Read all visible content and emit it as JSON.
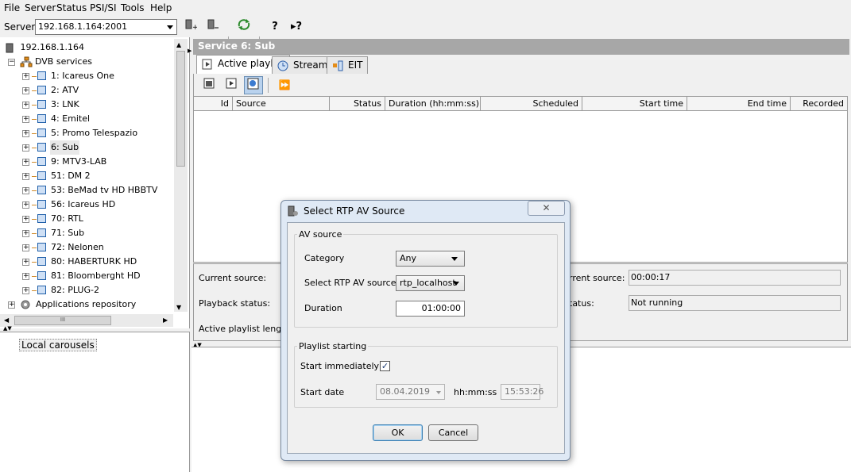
{
  "menu": [
    "File",
    "Server",
    "Status",
    "PSI/SI",
    "Tools",
    "Help"
  ],
  "toolbar": {
    "server_label": "Server",
    "server_value": "192.168.1.164:2001"
  },
  "tree": {
    "root": "192.168.1.164",
    "dvb": "DVB services",
    "services": [
      "1: Icareus One",
      "2: ATV",
      "3: LNK",
      "4: Emitel",
      "5: Promo Telespazio",
      "6: Sub",
      "9: MTV3-LAB",
      "51: DM 2",
      "53: BeMad tv HD HBBTV",
      "56: Icareus HD",
      "70: RTL",
      "71: Sub",
      "72: Nelonen",
      "80: HABERTURK HD",
      "81: Bloomberght HD",
      "82: PLUG-2"
    ],
    "apps": "Applications repository",
    "selected_index": 5
  },
  "lower_left": {
    "item": "Local carousels"
  },
  "main": {
    "service_title": "Service 6: Sub",
    "tabs": [
      "Active playlist",
      "Streams",
      "EIT"
    ],
    "columns": [
      "Id",
      "Source",
      "Status",
      "Duration (hh:mm:ss)",
      "Scheduled",
      "Start time",
      "End time",
      "Recorded"
    ],
    "details": {
      "current_source_label": "Current source:",
      "playback_status_label": "Playback status:",
      "playlist_length_label": "Active playlist length:",
      "right_current_source_label": "rrent source:",
      "right_current_source_value": "00:00:17",
      "right_status_label": "tatus:",
      "right_status_value": "Not running"
    }
  },
  "dialog": {
    "title": "Select RTP AV Source",
    "av_group": "AV source",
    "category_label": "Category",
    "category_value": "Any",
    "rtp_label": "Select RTP AV source",
    "rtp_value": "rtp_localhost",
    "duration_label": "Duration",
    "duration_value": "01:00:00",
    "playlist_group": "Playlist starting",
    "start_immediately_label": "Start immediately",
    "start_immediately_checked": true,
    "start_date_label": "Start date",
    "start_date_value": "08.04.2019",
    "time_label": "hh:mm:ss",
    "time_value": "15:53:26",
    "ok": "OK",
    "cancel": "Cancel"
  }
}
